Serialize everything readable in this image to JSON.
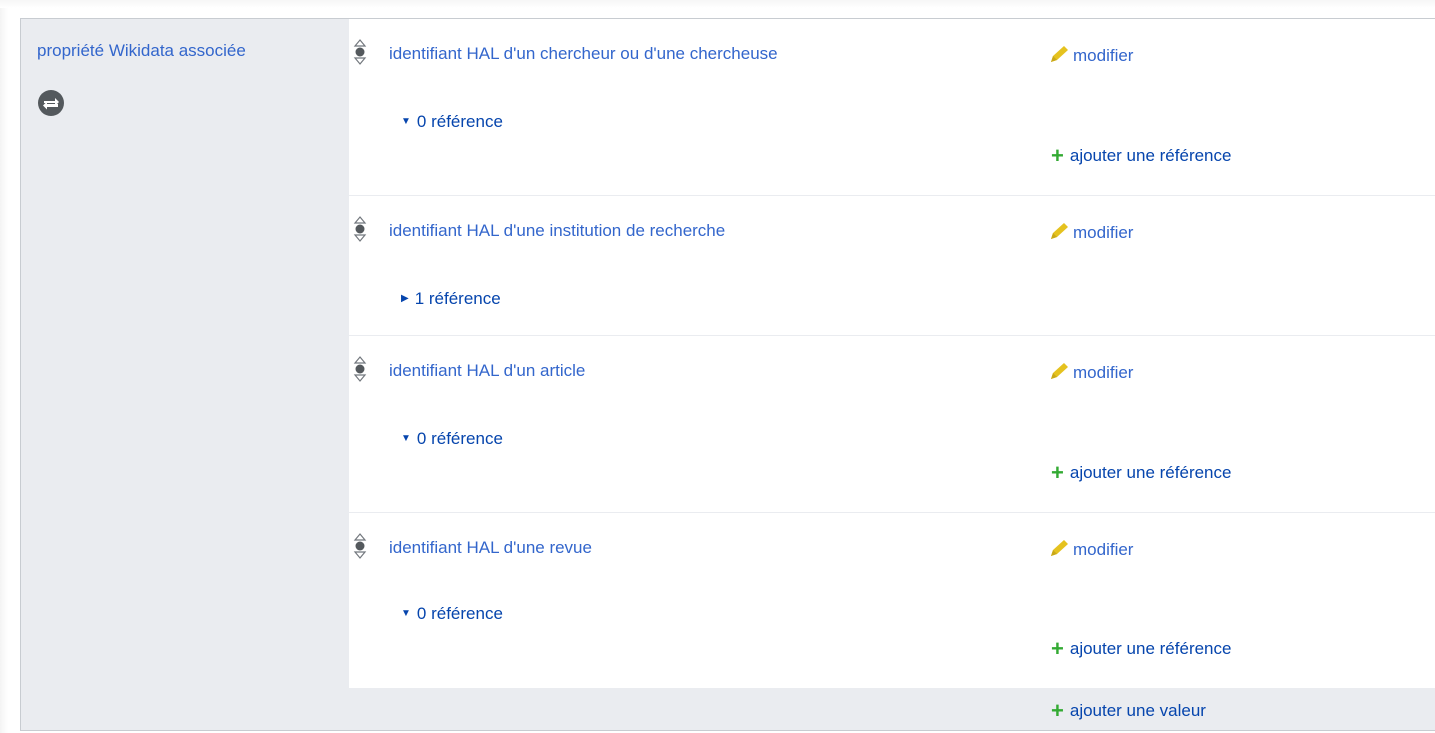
{
  "property": {
    "label": "propriété Wikidata associée",
    "icon": "wikidata-sync-icon"
  },
  "statements": [
    {
      "value": "identifiant HAL d'un chercheur ou d'une chercheuse",
      "edit_label": "modifier",
      "references_label": "0 référence",
      "references_expanded": true,
      "add_reference_label": "ajouter une référence"
    },
    {
      "value": "identifiant HAL d'une institution de recherche",
      "edit_label": "modifier",
      "references_label": "1 référence",
      "references_expanded": false,
      "add_reference_label": ""
    },
    {
      "value": "identifiant HAL d'un article",
      "edit_label": "modifier",
      "references_label": "0 référence",
      "references_expanded": true,
      "add_reference_label": "ajouter une référence"
    },
    {
      "value": "identifiant HAL d'une revue",
      "edit_label": "modifier",
      "references_label": "0 référence",
      "references_expanded": true,
      "add_reference_label": "ajouter une référence"
    }
  ],
  "add_value_label": "ajouter une valeur",
  "colors": {
    "link": "#3366cc",
    "group_bg": "#eaecf0",
    "pencil": "#e5c21f",
    "plus": "#33aa33"
  }
}
